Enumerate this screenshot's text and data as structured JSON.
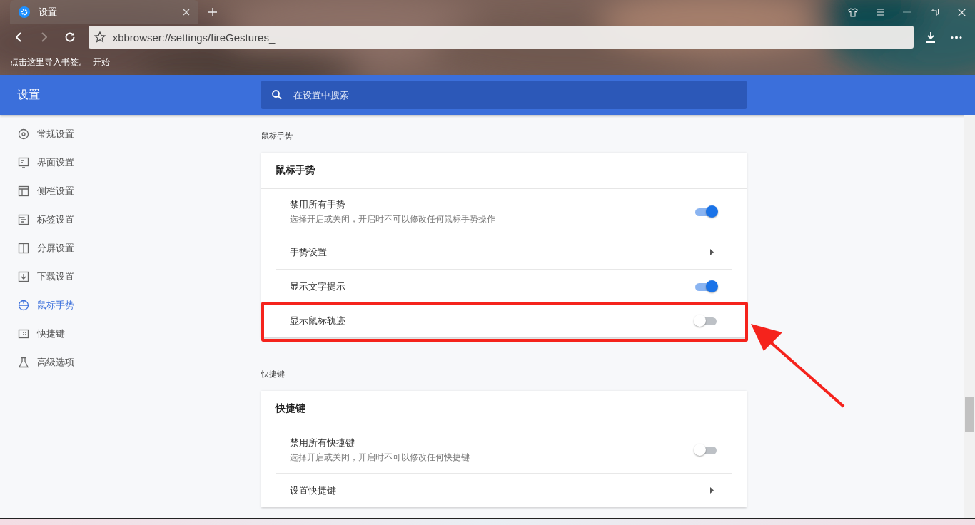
{
  "tab": {
    "title": "设置",
    "selected": true
  },
  "address_bar": {
    "value": "xbbrowser://settings/fireGestures_"
  },
  "bookmark_bar": {
    "text": "点击这里导入书签。",
    "link": "开始"
  },
  "header": {
    "title": "设置",
    "search": {
      "placeholder": "在设置中搜索"
    }
  },
  "sidebar": {
    "items": [
      {
        "label": "常规设置",
        "selected": false
      },
      {
        "label": "界面设置",
        "selected": false
      },
      {
        "label": "侧栏设置",
        "selected": false
      },
      {
        "label": "标签设置",
        "selected": false
      },
      {
        "label": "分屏设置",
        "selected": false
      },
      {
        "label": "下载设置",
        "selected": false
      },
      {
        "label": "鼠标手势",
        "selected": true
      },
      {
        "label": "快捷键",
        "selected": false
      },
      {
        "label": "高级选项",
        "selected": false
      }
    ]
  },
  "sections": [
    {
      "label": "鼠标手势",
      "card_title": "鼠标手势",
      "rows": [
        {
          "kind": "toggle",
          "title": "禁用所有手势",
          "description": "选择开启或关闭，开启时不可以修改任何鼠标手势操作",
          "on": true,
          "highlighted": false
        },
        {
          "kind": "link",
          "title": "手势设置",
          "highlighted": false
        },
        {
          "kind": "toggle",
          "title": "显示文字提示",
          "on": true,
          "highlighted": false
        },
        {
          "kind": "toggle",
          "title": "显示鼠标轨迹",
          "on": false,
          "highlighted": true
        }
      ]
    },
    {
      "label": "快捷键",
      "card_title": "快捷键",
      "rows": [
        {
          "kind": "toggle",
          "title": "禁用所有快捷键",
          "description": "选择开启或关闭，开启时不可以修改任何快捷键",
          "on": false,
          "highlighted": false
        },
        {
          "kind": "link",
          "title": "设置快捷键",
          "highlighted": false
        }
      ]
    }
  ]
}
